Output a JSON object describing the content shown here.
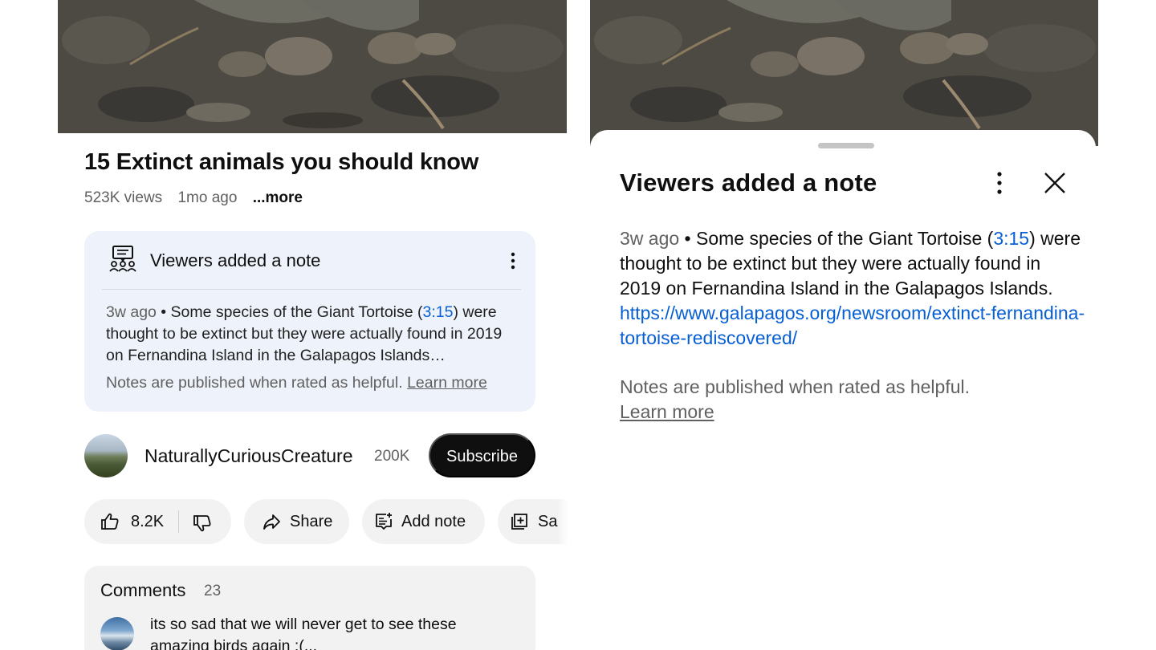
{
  "left": {
    "video": {
      "title": "15 Extinct animals you should know",
      "views": "523K views",
      "age": "1mo ago",
      "more": "...more"
    },
    "note_card": {
      "title": "Viewers added a note",
      "ago": "3w ago",
      "text_before_ts": " • Some species of the Giant Tortoise (",
      "timestamp": "3:15",
      "text_after_ts": ") were thought to be extinct but they were actually found in 2019 on Fernandina Island in the Galapagos Islands…",
      "published": "Notes are published when rated as helpful.",
      "learn_more": "Learn more",
      "icons": [
        "community-notes-icon",
        "more-vertical-icon"
      ]
    },
    "channel": {
      "name": "NaturallyCuriousCreature",
      "subscribers": "200K",
      "subscribe_label": "Subscribe"
    },
    "actions": {
      "like_count": "8.2K",
      "share_label": "Share",
      "add_note_label": "Add note",
      "save_label": "Sa",
      "icons": [
        "thumbs-up-icon",
        "thumbs-down-icon",
        "share-icon",
        "add-note-icon",
        "save-icon"
      ]
    },
    "comments": {
      "title": "Comments",
      "count": "23",
      "first_comment": "its so sad that we will never get to see these amazing birds again :(..."
    }
  },
  "right": {
    "sheet": {
      "title": "Viewers added a note",
      "ago": "3w ago",
      "text_before_ts": " • Some species of the Giant Tortoise (",
      "timestamp": "3:15",
      "text_after_ts": ") were thought to be extinct but they were actually found in 2019 on Fernandina Island in the Galapagos Islands. ",
      "url": "https://www.galapagos.org/newsroom/extinct-fernandina-tortoise-rediscovered/",
      "published": "Notes are published when rated as helpful.",
      "learn_more": "Learn more",
      "icons": [
        "more-vertical-icon",
        "close-icon"
      ]
    }
  },
  "colors": {
    "link_blue": "#065fd4",
    "note_card_bg": "#eef3fb",
    "pill_bg": "#f2f2f2",
    "subscribe_bg": "#0f0f0f",
    "secondary_text": "#606060"
  }
}
